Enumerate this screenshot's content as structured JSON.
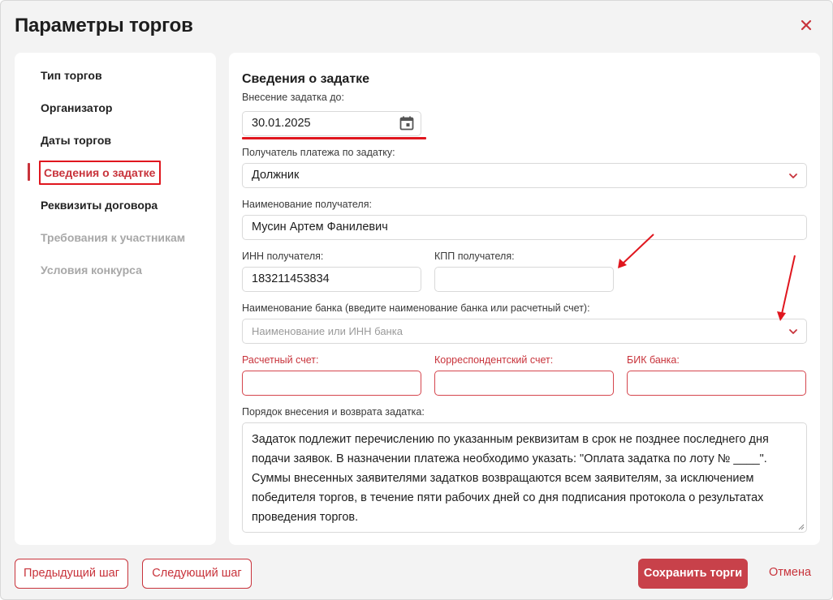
{
  "modal": {
    "title": "Параметры торгов",
    "close_icon": "close-icon"
  },
  "sidebar": {
    "items": [
      {
        "label": "Тип торгов",
        "state": "normal"
      },
      {
        "label": "Организатор",
        "state": "normal"
      },
      {
        "label": "Даты торгов",
        "state": "normal"
      },
      {
        "label": "Сведения о задатке",
        "state": "active"
      },
      {
        "label": "Реквизиты договора",
        "state": "normal"
      },
      {
        "label": "Требования к участникам",
        "state": "disabled"
      },
      {
        "label": "Условия конкурса",
        "state": "disabled"
      }
    ]
  },
  "form": {
    "section_title": "Сведения о задатке",
    "deposit_deadline": {
      "label": "Внесение задатка до:",
      "value": "30.01.2025",
      "icon": "calendar-icon"
    },
    "payment_recipient": {
      "label": "Получатель платежа по задатку:",
      "value": "Должник",
      "icon": "chevron-down-icon"
    },
    "recipient_name": {
      "label": "Наименование получателя:",
      "value": "Мусин Артем Фанилевич"
    },
    "inn": {
      "label": "ИНН получателя:",
      "value": "183211453834"
    },
    "kpp": {
      "label": "КПП получателя:",
      "value": ""
    },
    "bank_name": {
      "label": "Наименование банка (введите наименование банка или расчетный счет):",
      "placeholder": "Наименование или ИНН банка",
      "icon": "chevron-down-icon"
    },
    "account": {
      "label": "Расчетный счет:",
      "value": ""
    },
    "corr_account": {
      "label": "Корреспондентский счет:",
      "value": ""
    },
    "bik": {
      "label": "БИК банка:",
      "value": ""
    },
    "deposit_procedure": {
      "label": "Порядок внесения и возврата задатка:",
      "value": "Задаток подлежит перечислению по указанным реквизитам в срок не позднее последнего дня подачи заявок. В назначении платежа необходимо указать: \"Оплата задатка по лоту № ____\". Суммы внесенных заявителями задатков возвращаются всем заявителям, за исключением победителя торгов, в течение пяти рабочих дней со дня подписания протокола о результатах проведения торгов."
    }
  },
  "footer": {
    "prev_label": "Предыдущий шаг",
    "next_label": "Следующий шаг",
    "save_label": "Сохранить торги",
    "cancel_label": "Отмена"
  },
  "colors": {
    "accent": "#c8333b",
    "annotation_red": "#e0161e",
    "background": "#f3f3f3"
  }
}
